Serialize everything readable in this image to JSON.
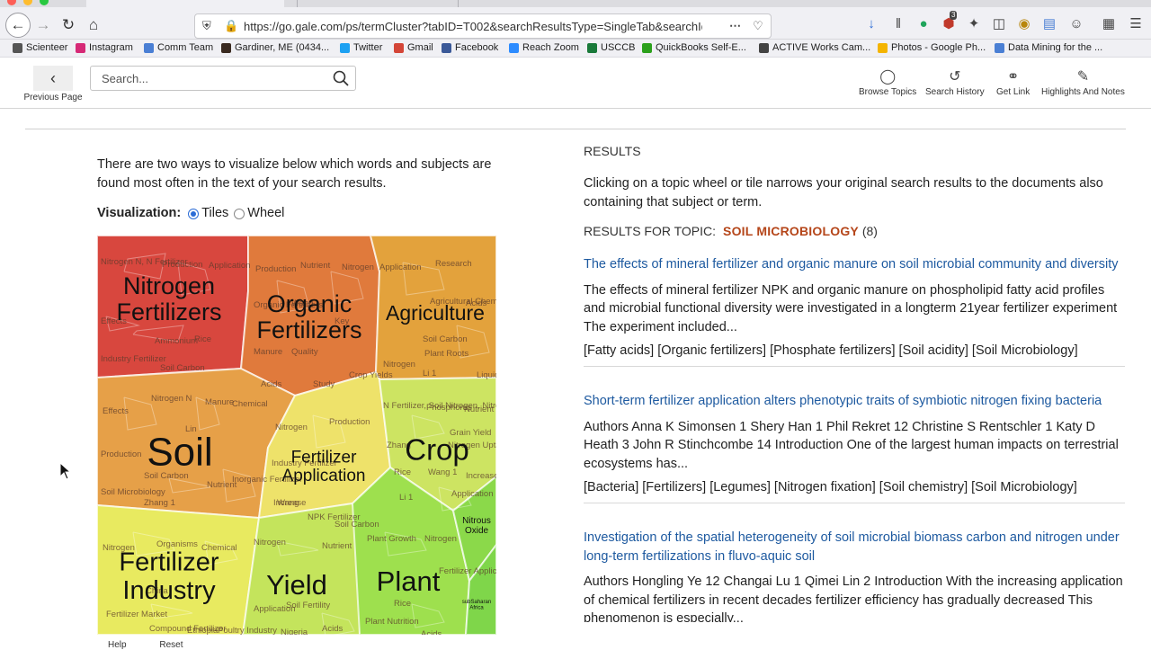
{
  "browser": {
    "url": "https://go.gale.com/ps/termCluster?tabID=T002&searchResultsType=SingleTab&searchId",
    "bookmarks": [
      "Scienteer",
      "Instagram",
      "Comm Team",
      "Gardiner, ME (0434...",
      "Twitter",
      "Gmail",
      "Facebook",
      "Reach Zoom",
      "USCCB",
      "QuickBooks Self-E...",
      "ACTIVE Works Cam...",
      "Photos - Google Ph...",
      "Data Mining for the ..."
    ],
    "notification_badge": "3"
  },
  "header": {
    "previous_page": "Previous Page",
    "search_placeholder": "Search...",
    "tools": [
      "Browse Topics",
      "Search History",
      "Get Link",
      "Highlights And Notes"
    ]
  },
  "left": {
    "intro": "There are two ways to visualize below which words and subjects are found most often in the text of your search results.",
    "viz_label": "Visualization:",
    "viz_options": [
      "Tiles",
      "Wheel"
    ],
    "viz_selected": "Tiles",
    "footer_help": "Help",
    "footer_reset": "Reset"
  },
  "tiles": {
    "big": [
      {
        "lines": [
          "Nitrogen",
          "Fertilizers"
        ],
        "color": "#d8473e"
      },
      {
        "lines": [
          "Organic",
          "Fertilizers"
        ],
        "color": "#e07a3c"
      },
      {
        "lines": [
          "Agriculture"
        ],
        "color": "#e3a23c"
      },
      {
        "lines": [
          "Soil"
        ],
        "color": "#e6a048"
      },
      {
        "lines": [
          "Fertilizer",
          "Application"
        ],
        "color": "#eee26a"
      },
      {
        "lines": [
          "Crop"
        ],
        "color": "#cde462"
      },
      {
        "lines": [
          "Fertilizer",
          "Industry"
        ],
        "color": "#e8ea60"
      },
      {
        "lines": [
          "Yield"
        ],
        "color": "#c4e45c"
      },
      {
        "lines": [
          "Plant"
        ],
        "color": "#9ee04e"
      },
      {
        "lines": [
          "Nitrous",
          "Oxide"
        ],
        "color": "#8bd94a"
      },
      {
        "lines": [
          "subSaharan",
          "Africa"
        ],
        "color": "#7fd64a"
      }
    ],
    "small": [
      "Nitrogen N, N Fertilizer",
      "Production",
      "Application",
      "Effects",
      "Rice",
      "Ammonium",
      "Industry Fertilizer",
      "Soil Carbon",
      "Production",
      "Nutrient",
      "Nitrogen",
      "Organic Fertilizers",
      "Wang",
      "Manure",
      "Quality",
      "Key",
      "Acids",
      "Study",
      "Crop Yields",
      "Application",
      "Research",
      "Agricultural Chemicals",
      "Acids",
      "Nitrogen",
      "Soil Carbon",
      "Plant Roots",
      "Li 1",
      "Liquid",
      "Effects",
      "Nitrogen N",
      "Manure",
      "Chemical",
      "Lin",
      "Production",
      "Soil Carbon",
      "Soil Microbiology",
      "Zhang 1",
      "Nutrient",
      "Inorganic Fertilizer",
      "Nitrogen",
      "Production",
      "Industry Fertilizer",
      "Wang",
      "Increase",
      "NPK Fertilizer",
      "Soil Carbon",
      "N Fertilizer, Soil Nitrogen, Nitrogen N",
      "Phosphorus",
      "Nutrient",
      "Grain Yield",
      "Nitrogen Uptake",
      "Zhang",
      "Rice",
      "Wang 1",
      "Increase",
      "Li 1",
      "Application",
      "Nitrogen",
      "Organisms",
      "Chemical",
      "China",
      "Fertilizer Market",
      "Compound Fertilizer",
      "Ethiopia",
      "Poultry Industry",
      "Nitrogen",
      "Nutrient",
      "Soil Fertility",
      "Application",
      "Nigeria",
      "Acids",
      "Plant Growth",
      "Nitrogen",
      "Fertilizer Application",
      "Rice",
      "Plant Nutrition",
      "Acids"
    ]
  },
  "results": {
    "heading": "RESULTS",
    "description": "Clicking on a topic wheel or tile narrows your original search results to the documents also containing that subject or term.",
    "topic_label": "RESULTS FOR TOPIC:",
    "topic_name": "SOIL MICROBIOLOGY",
    "topic_count": "(8)",
    "items": [
      {
        "title": "The effects of mineral fertilizer and organic manure on soil microbial community and diversity",
        "abstract": "The effects of mineral fertilizer NPK and organic manure on phospholipid fatty acid profiles and microbial functional diversity were investigated in a longterm 21year fertilizer experiment The experiment included...",
        "subjects": "[Fatty acids] [Organic fertilizers] [Phosphate fertilizers] [Soil acidity] [Soil Microbiology]"
      },
      {
        "title": "Short-term fertilizer application alters phenotypic traits of symbiotic nitrogen fixing bacteria",
        "abstract": "Authors Anna K Simonsen 1 Shery Han 1 Phil Rekret 12 Christine S Rentschler 1 Katy D Heath 3 John R Stinchcombe 14 Introduction One of the largest human impacts on terrestrial ecosystems has...",
        "subjects": "[Bacteria] [Fertilizers] [Legumes] [Nitrogen fixation] [Soil chemistry] [Soil Microbiology]"
      },
      {
        "title": "Investigation of the spatial heterogeneity of soil microbial biomass carbon and nitrogen under long-term fertilizations in fluvo-aquic soil",
        "abstract": "Authors Hongling Ye 12 Changai Lu 1 Qimei Lin 2 Introduction With the increasing application of chemical fertilizers in recent decades fertilizer efficiency has gradually decreased This phenomenon is especially...",
        "subjects": ""
      }
    ]
  }
}
